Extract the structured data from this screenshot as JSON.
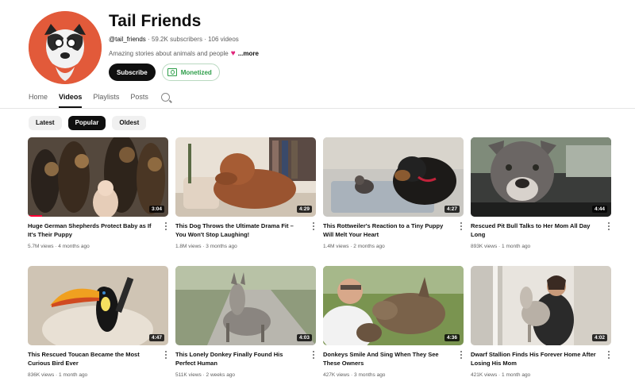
{
  "channel": {
    "name": "Tail Friends",
    "handle": "@tail_friends",
    "subscribers": "59.2K subscribers",
    "videos_count": "106 videos",
    "description": "Amazing stories about animals and people",
    "more": "...more",
    "subscribe_label": "Subscribe",
    "monetized_label": "Monetized",
    "avatar_color": "#e25a3a"
  },
  "tabs": [
    {
      "label": "Home"
    },
    {
      "label": "Videos"
    },
    {
      "label": "Playlists"
    },
    {
      "label": "Posts"
    }
  ],
  "chips": [
    {
      "label": "Latest"
    },
    {
      "label": "Popular"
    },
    {
      "label": "Oldest"
    }
  ],
  "videos": [
    {
      "title": "Huge German Shepherds Protect Baby as If It's Their Puppy",
      "views": "5.7M views",
      "age": "4 months ago",
      "duration": "3:04"
    },
    {
      "title": "This Dog Throws the Ultimate Drama Fit – You Won't Stop Laughing!",
      "views": "1.8M views",
      "age": "3 months ago",
      "duration": "4:29"
    },
    {
      "title": "This Rottweiler's Reaction to a Tiny Puppy Will Melt Your Heart",
      "views": "1.4M views",
      "age": "2 months ago",
      "duration": "4:27"
    },
    {
      "title": "Rescued Pit Bull Talks to Her Mom All Day Long",
      "views": "893K views",
      "age": "1 month ago",
      "duration": "4:44"
    },
    {
      "title": "This Rescued Toucan Became the Most Curious Bird Ever",
      "views": "836K views",
      "age": "1 month ago",
      "duration": "4:47"
    },
    {
      "title": "This Lonely Donkey Finally Found His Perfect Human",
      "views": "511K views",
      "age": "2 weeks ago",
      "duration": "4:03"
    },
    {
      "title": "Donkeys Smile And Sing When They See These Owners",
      "views": "427K views",
      "age": "3 months ago",
      "duration": "4:36"
    },
    {
      "title": "Dwarf Stallion Finds His Forever Home After Losing His Mom",
      "views": "421K views",
      "age": "1 month ago",
      "duration": "4:02"
    }
  ]
}
